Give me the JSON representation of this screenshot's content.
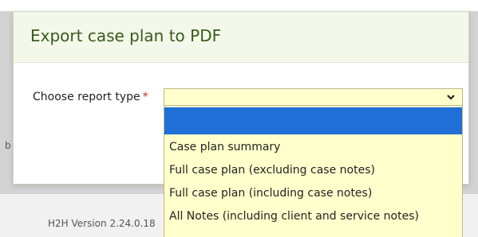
{
  "dialog": {
    "title": "Export case plan to PDF",
    "field_label": "Choose report type",
    "required_mark": "*"
  },
  "select": {
    "selected_value": "",
    "options": [
      {
        "label": ""
      },
      {
        "label": "Case plan summary"
      },
      {
        "label": "Full case plan (excluding case notes)"
      },
      {
        "label": "Full case plan (including case notes)"
      },
      {
        "label": "All Notes (including client and service notes)"
      }
    ]
  },
  "footer": {
    "version_text": "H2H Version 2.24.0.18"
  },
  "background": {
    "edge_text": "b"
  },
  "colors": {
    "select_background": "#ffffcc",
    "highlight": "#1f6fd6",
    "header_background": "#f3f8ea",
    "required": "#cc2222"
  }
}
